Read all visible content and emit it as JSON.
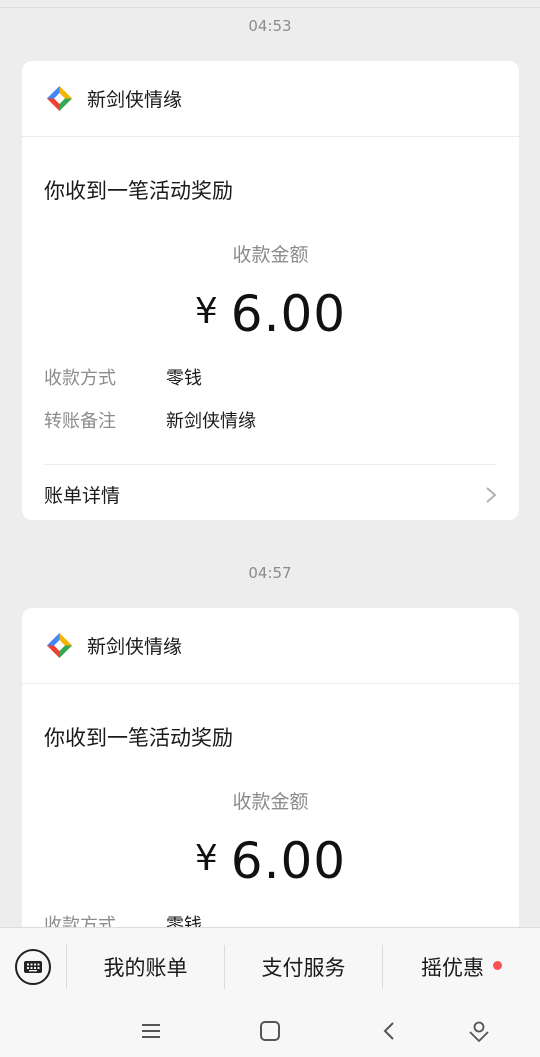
{
  "messages": [
    {
      "timestamp": "04:53",
      "sender": "新剑侠情缘",
      "title": "你收到一笔活动奖励",
      "amount_label": "收款金额",
      "currency": "¥",
      "amount": "6.00",
      "fields": [
        {
          "label": "收款方式",
          "value": "零钱"
        },
        {
          "label": "转账备注",
          "value": "新剑侠情缘"
        }
      ],
      "detail_label": "账单详情"
    },
    {
      "timestamp": "04:57",
      "sender": "新剑侠情缘",
      "title": "你收到一笔活动奖励",
      "amount_label": "收款金额",
      "currency": "¥",
      "amount": "6.00",
      "fields": [
        {
          "label": "收款方式",
          "value": "零钱"
        }
      ]
    }
  ],
  "tabbar": {
    "keyboard_icon": "keyboard-icon",
    "tabs": [
      {
        "label": "我的账单"
      },
      {
        "label": "支付服务"
      },
      {
        "label": "摇优惠",
        "has_badge": true
      }
    ],
    "badge_color": "#fa5151"
  },
  "navbar": {
    "icons": [
      "menu-icon",
      "home-icon",
      "back-icon",
      "assistant-icon"
    ]
  }
}
